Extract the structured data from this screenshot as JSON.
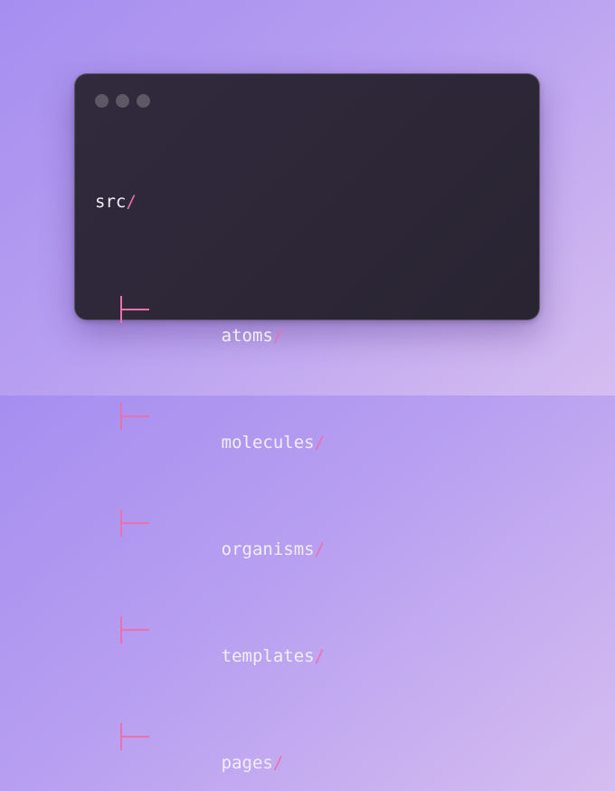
{
  "window": {
    "controls": [
      "dot",
      "dot",
      "dot"
    ]
  },
  "tree": {
    "root": "src",
    "separator": "/",
    "children": [
      {
        "name": "atoms"
      },
      {
        "name": "molecules"
      },
      {
        "name": "organisms"
      },
      {
        "name": "templates"
      },
      {
        "name": "pages"
      }
    ]
  },
  "colors": {
    "accent": "#ec6fb0",
    "text": "#f1eef6",
    "window_bg": "#2e2839",
    "dot": "#5c5866",
    "background_start": "#a58ef0",
    "background_end": "#d5bdf0"
  }
}
